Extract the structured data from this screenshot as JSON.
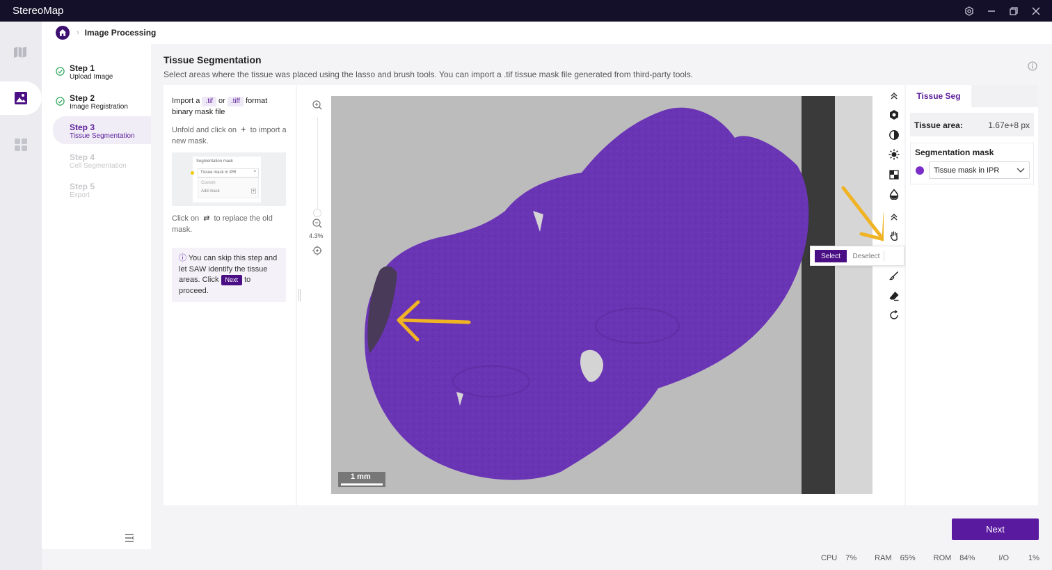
{
  "app": {
    "title": "StereoMap"
  },
  "breadcrumb": {
    "current": "Image Processing"
  },
  "steps": [
    {
      "title": "Step 1",
      "subtitle": "Upload Image",
      "state": "done"
    },
    {
      "title": "Step 2",
      "subtitle": "Image Registration",
      "state": "done"
    },
    {
      "title": "Step 3",
      "subtitle": "Tissue Segmentation",
      "state": "active"
    },
    {
      "title": "Step 4",
      "subtitle": "Cell Segmentation",
      "state": "disabled"
    },
    {
      "title": "Step 5",
      "subtitle": "Export",
      "state": "disabled"
    }
  ],
  "main": {
    "title": "Tissue Segmentation",
    "description": "Select areas where the tissue was placed using the lasso and brush tools. You can import a .tif tissue mask file generated from third-party tools."
  },
  "instructions": {
    "line1_a": "Import a",
    "tag_tif": ".tif",
    "line1_or": "or",
    "tag_tiff": ".tiff",
    "line1_b": "format binary mask file",
    "unfold_a": "Unfold and click on",
    "unfold_b": "to import a new mask.",
    "mini_header": "Segmentation mask",
    "mini_select": "Tissue mask in IPR",
    "mini_custom": "Custom",
    "mini_add": "Add mask",
    "replace_a": "Click on",
    "replace_b": "to replace the old mask.",
    "hint_a": "You can skip this step and let SAW identify the tissue areas. Click",
    "hint_next": "Next",
    "hint_b": "to proceed."
  },
  "viewer": {
    "zoom_percent": "4.3%",
    "scale_bar_label": "1 mm"
  },
  "popover": {
    "select_label": "Select",
    "deselect_label": "Deselect"
  },
  "right_panel": {
    "tab": "Tissue Seg",
    "tissue_area_label": "Tissue area:",
    "tissue_area_value": "1.67e+8 px",
    "mask_title": "Segmentation mask",
    "mask_selected": "Tissue mask in IPR"
  },
  "footer": {
    "next_label": "Next",
    "stats": [
      {
        "label": "CPU",
        "value": "7%"
      },
      {
        "label": "RAM",
        "value": "65%"
      },
      {
        "label": "ROM",
        "value": "84%"
      },
      {
        "label": "I/O",
        "value": "1%"
      }
    ]
  },
  "colors": {
    "accent": "#5a1aa0",
    "titlebar": "#14102a",
    "annotation_arrow": "#f0b323",
    "mask": "#6a35b5"
  }
}
